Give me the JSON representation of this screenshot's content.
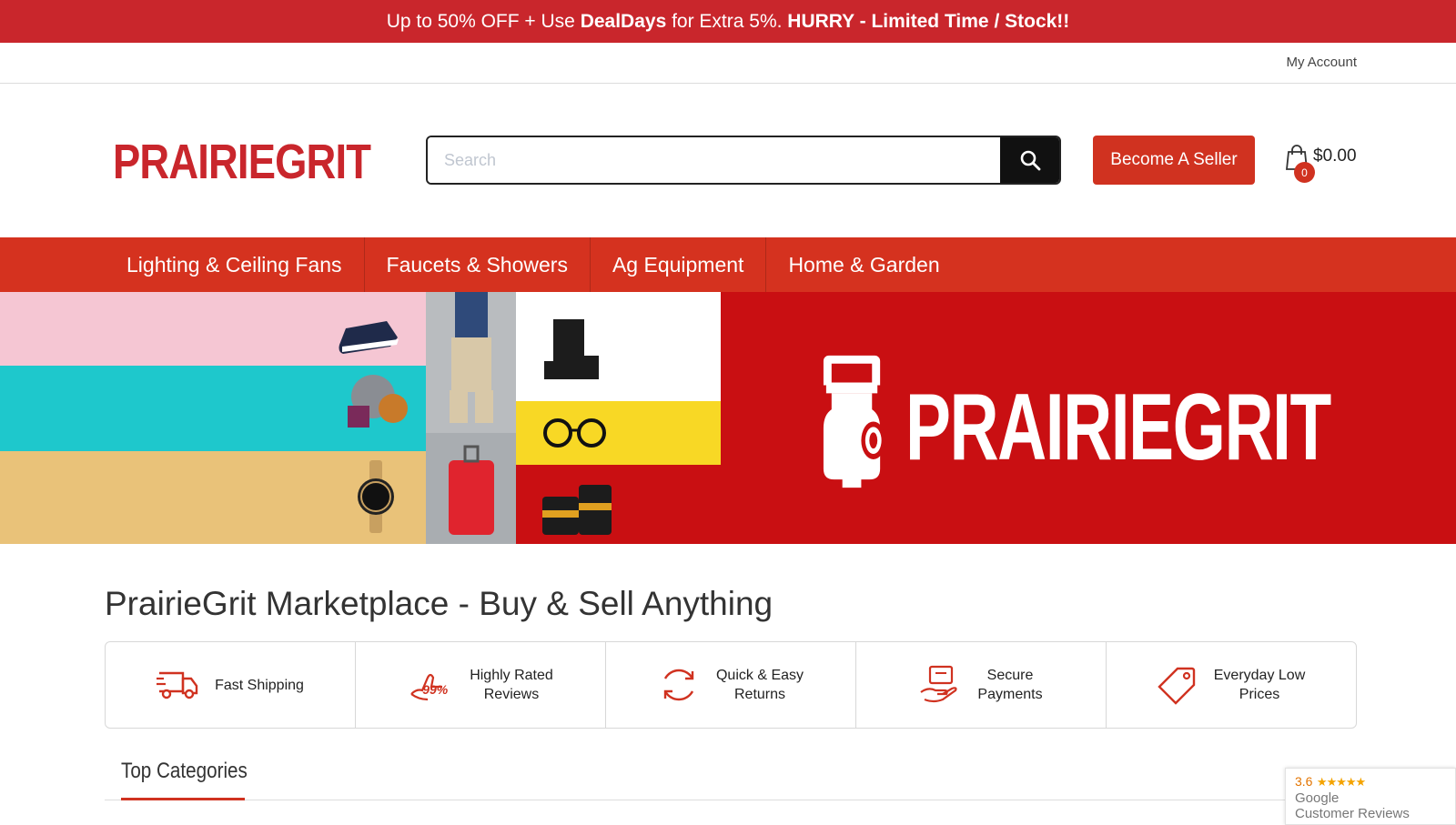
{
  "promo": {
    "part1": "Up to 50% OFF + Use ",
    "part2": "DealDays",
    "part3": " for Extra 5%. ",
    "part4": "HURRY - Limited Time / Stock!!"
  },
  "topbar": {
    "my_account": "My Account"
  },
  "header": {
    "logo_text": "PRAIRIEGRIT",
    "search_placeholder": "Search",
    "seller_button": "Become A Seller",
    "cart_total": "$0.00",
    "cart_count": "0"
  },
  "nav": {
    "items": [
      {
        "label": "Lighting & Ceiling Fans"
      },
      {
        "label": "Faucets & Showers"
      },
      {
        "label": "Ag Equipment"
      },
      {
        "label": "Home & Garden"
      }
    ]
  },
  "hero": {
    "brand_text": "PRAIRIEGRIT",
    "colors": {
      "pink": "#f5c6d3",
      "teal": "#1ec8cc",
      "tan": "#e9c279",
      "red": "#c90f12",
      "yellow": "#f8d825",
      "grey": "#a9adb1"
    }
  },
  "page_title": "PrairieGrit Marketplace - Buy & Sell Anything",
  "features": [
    {
      "label": "Fast Shipping",
      "icon": "truck-icon"
    },
    {
      "label": "Highly Rated\nReviews",
      "icon": "thumbs-up-icon"
    },
    {
      "label": "Quick & Easy\nReturns",
      "icon": "refresh-icon"
    },
    {
      "label": "Secure\nPayments",
      "icon": "hand-payment-icon"
    },
    {
      "label": "Everyday Low\nPrices",
      "icon": "price-tag-icon"
    }
  ],
  "thumbs_badge": "99%",
  "top_categories": "Top Categories",
  "google_reviews": {
    "score": "3.6",
    "stars": "★★★★★",
    "name": "Google",
    "sub": "Customer Reviews"
  },
  "accent": "#d03220"
}
